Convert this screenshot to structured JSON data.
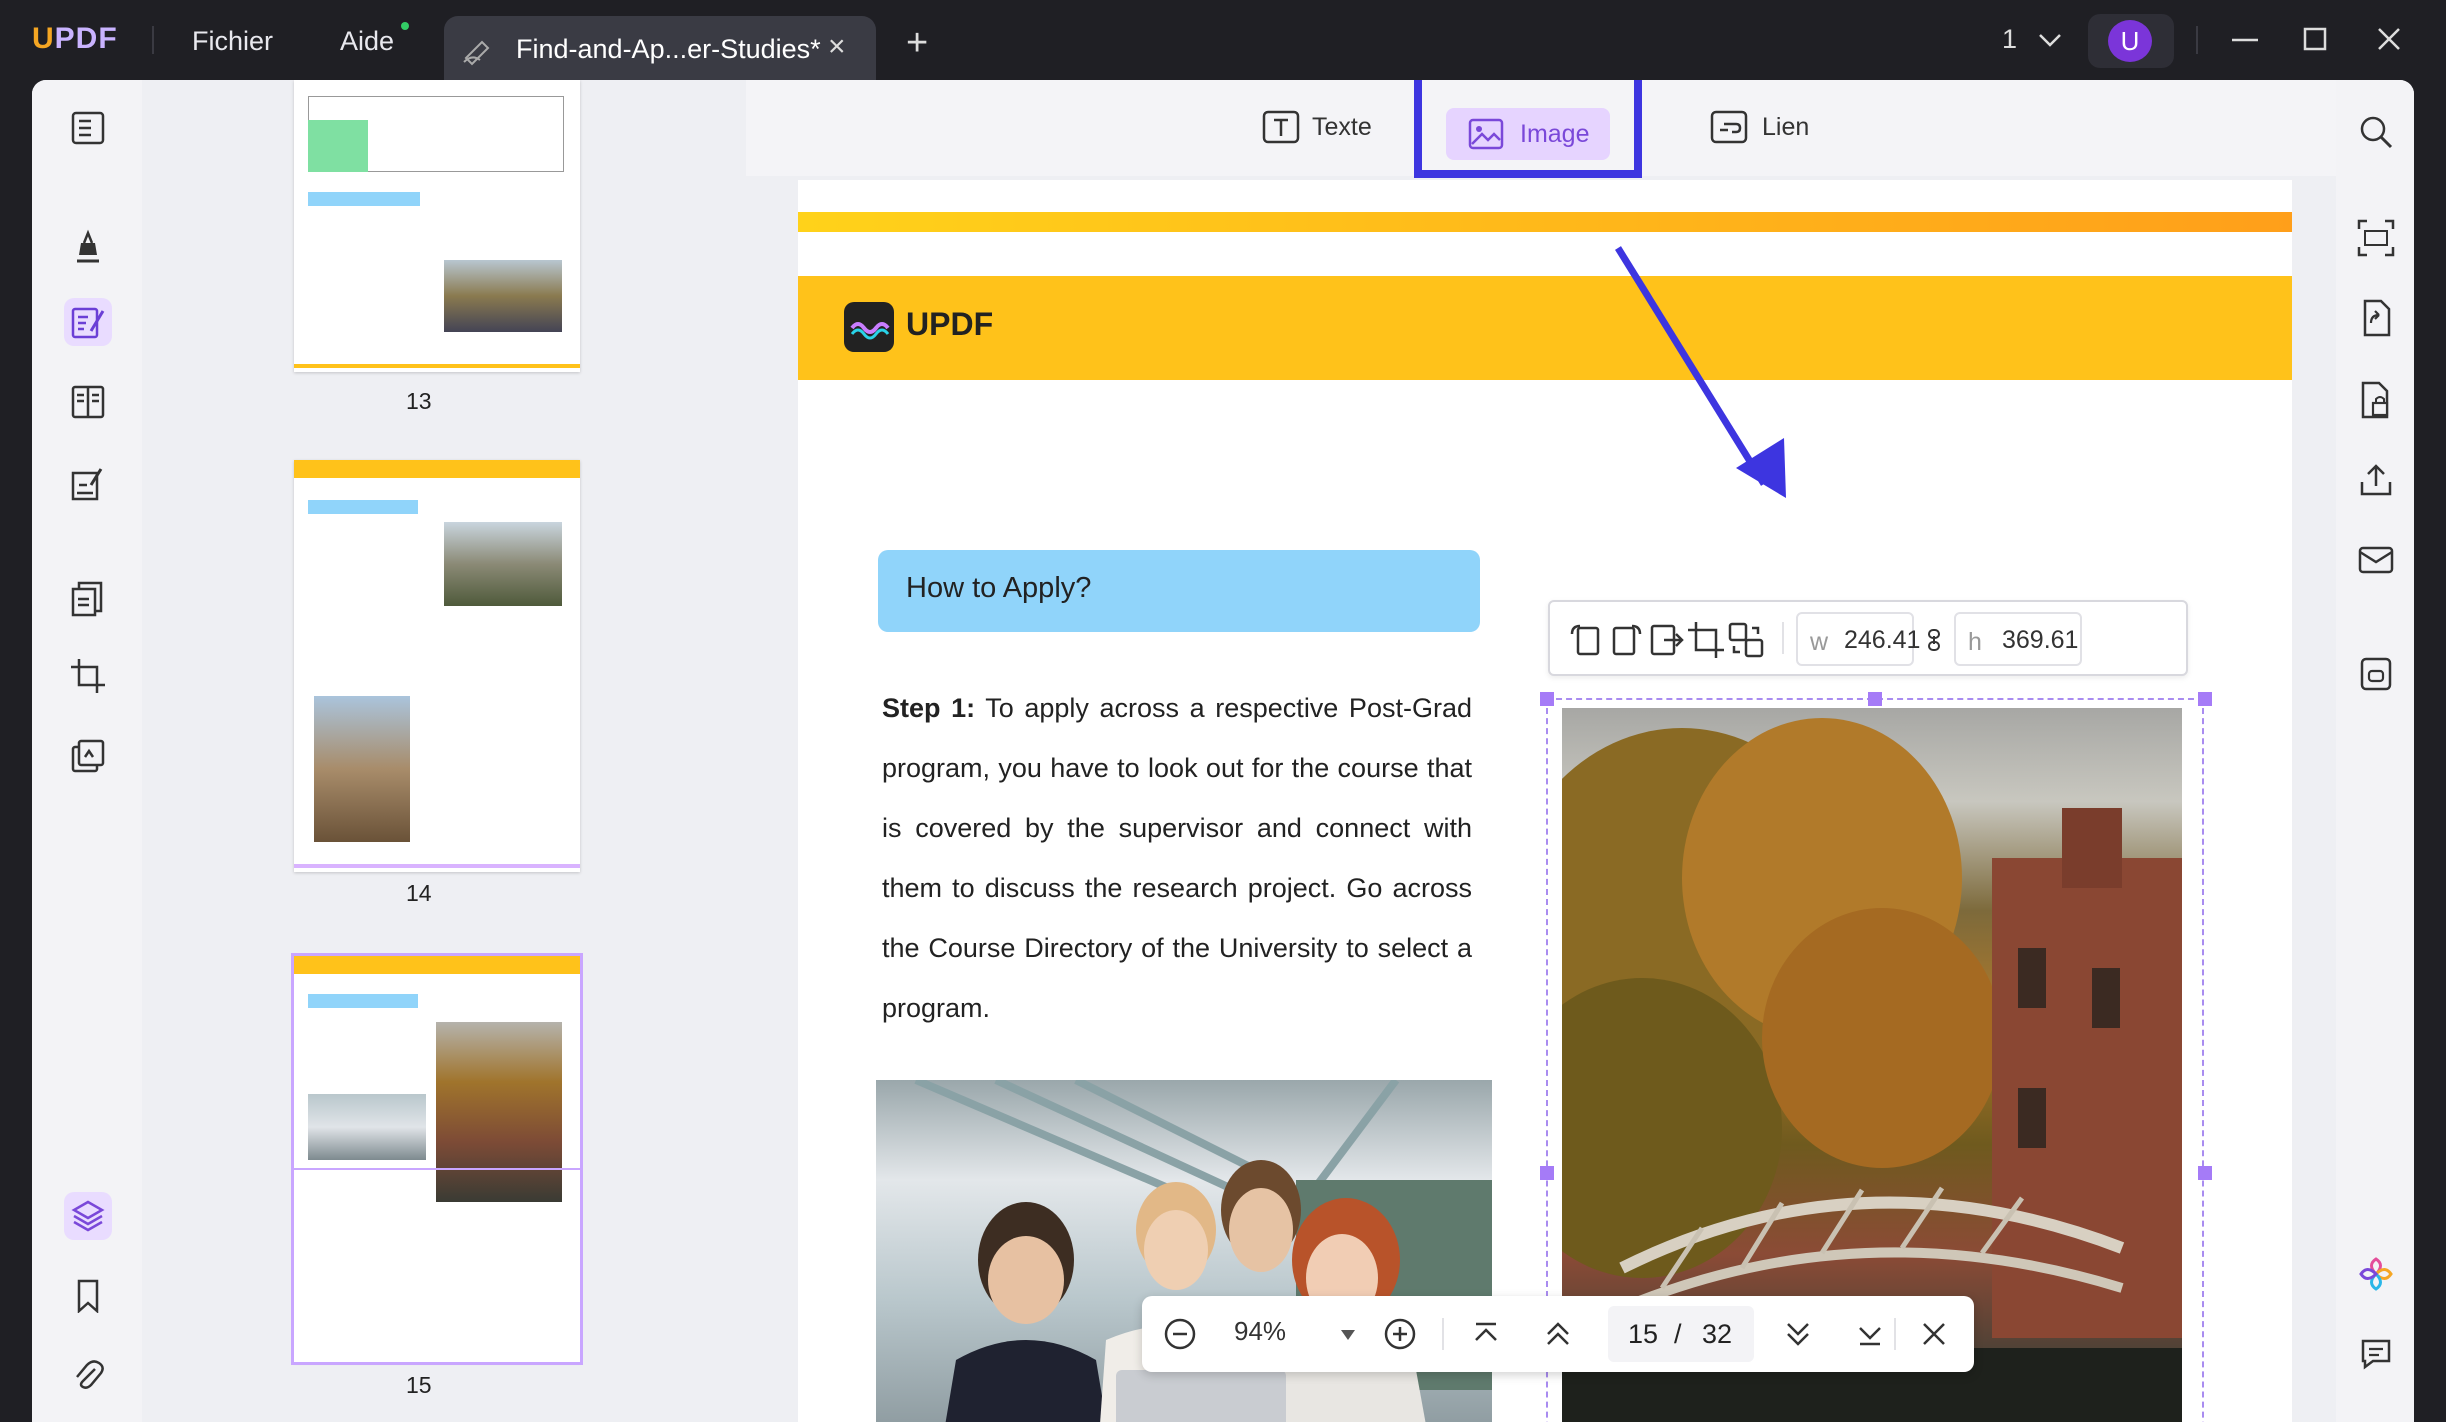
{
  "titlebar": {
    "logo": {
      "u": "U",
      "rest": "PDF"
    },
    "menu_file": "Fichier",
    "menu_help": "Aide",
    "tab_name": "Find-and-Ap...er-Studies*",
    "tab_close": "×",
    "new_tab": "+",
    "page_selector": "1",
    "user_initial": "U"
  },
  "thumbnails": [
    {
      "label": "13"
    },
    {
      "label": "14"
    },
    {
      "label": "15"
    }
  ],
  "edit_toolbar": {
    "text_label": "Texte",
    "image_label": "Image",
    "link_label": "Lien"
  },
  "page": {
    "brand": "UPDF",
    "heading": "How to Apply?",
    "step_label": "Step 1:",
    "step_text": " To apply across a respective Post-Grad program, you have to look out for the course that is covered by the supervisor and connect with them to discuss the research project. Go across the Course Directory of the University to select a program."
  },
  "image_toolbar": {
    "w_label": "w",
    "w_value": "246.41",
    "h_label": "h",
    "h_value": "369.61"
  },
  "zoombar": {
    "zoom": "94%",
    "current_page": "15",
    "separator": "/",
    "total_pages": "32"
  },
  "colors": {
    "accent": "#8a5cf0",
    "highlight": "#3d35e0",
    "banner": "#ffc21a"
  }
}
